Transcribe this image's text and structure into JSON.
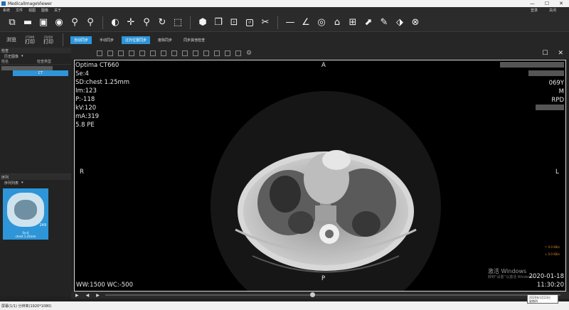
{
  "window": {
    "title": "MedicalImageViewer",
    "controls": [
      "—",
      "☐",
      "✕"
    ]
  },
  "menu": {
    "items": [
      "系统",
      "文件",
      "视图",
      "图像",
      "关于"
    ],
    "right": [
      "登录",
      "关闭"
    ]
  },
  "toolbar2": {
    "browse": "浏览",
    "print_ct": {
      "top": "CT/MR",
      "label": "打印"
    },
    "print_cr": {
      "top": "CR/DX",
      "label": "打印"
    },
    "sync_buttons": [
      {
        "label": "自动同步",
        "active": true
      },
      {
        "label": "手动同步",
        "active": false
      },
      {
        "label": "过外位置同步",
        "active": true
      },
      {
        "label": "废除同步",
        "active": false
      },
      {
        "label": "同步其他检查",
        "active": false
      }
    ]
  },
  "left_panel": {
    "study_header": "检查",
    "study_select": "历史图像",
    "study_columns": [
      "姓名",
      "检查类型"
    ],
    "study_row_type": "CT",
    "series_header": "序列",
    "series_select": "序列列表",
    "thumbnail": {
      "count": "249",
      "caption_line1": "Se:4",
      "caption_line2": "chest 1.25mm"
    }
  },
  "viewport": {
    "top_left": [
      "Optima CT660",
      "Se:4",
      "SD:chest 1.25mm",
      "Im:123",
      "P:-118",
      "kV:120",
      "mA:319",
      "5.8 PE"
    ],
    "top_right": [
      "069Y",
      "M",
      "RPD"
    ],
    "bottom_left": "WW:1500 WC:-500",
    "bottom_right": [
      "2020-01-18",
      "11:30:20"
    ],
    "orientation": {
      "top": "A",
      "bottom": "P",
      "left": "R",
      "right": "L"
    },
    "net_speed": [
      "↑ 0.0 KB/s",
      "↓ 0.0 KB/s"
    ],
    "watermark": {
      "line1": "激活 Windows",
      "line2": "转到“设置”以激活 Windows。"
    }
  },
  "statusbar": {
    "text": "屏幕(1/1) 分辨率(1920*1080)"
  },
  "tooltip": {
    "line1": "2020年1月23日",
    "line2": "星期四"
  }
}
